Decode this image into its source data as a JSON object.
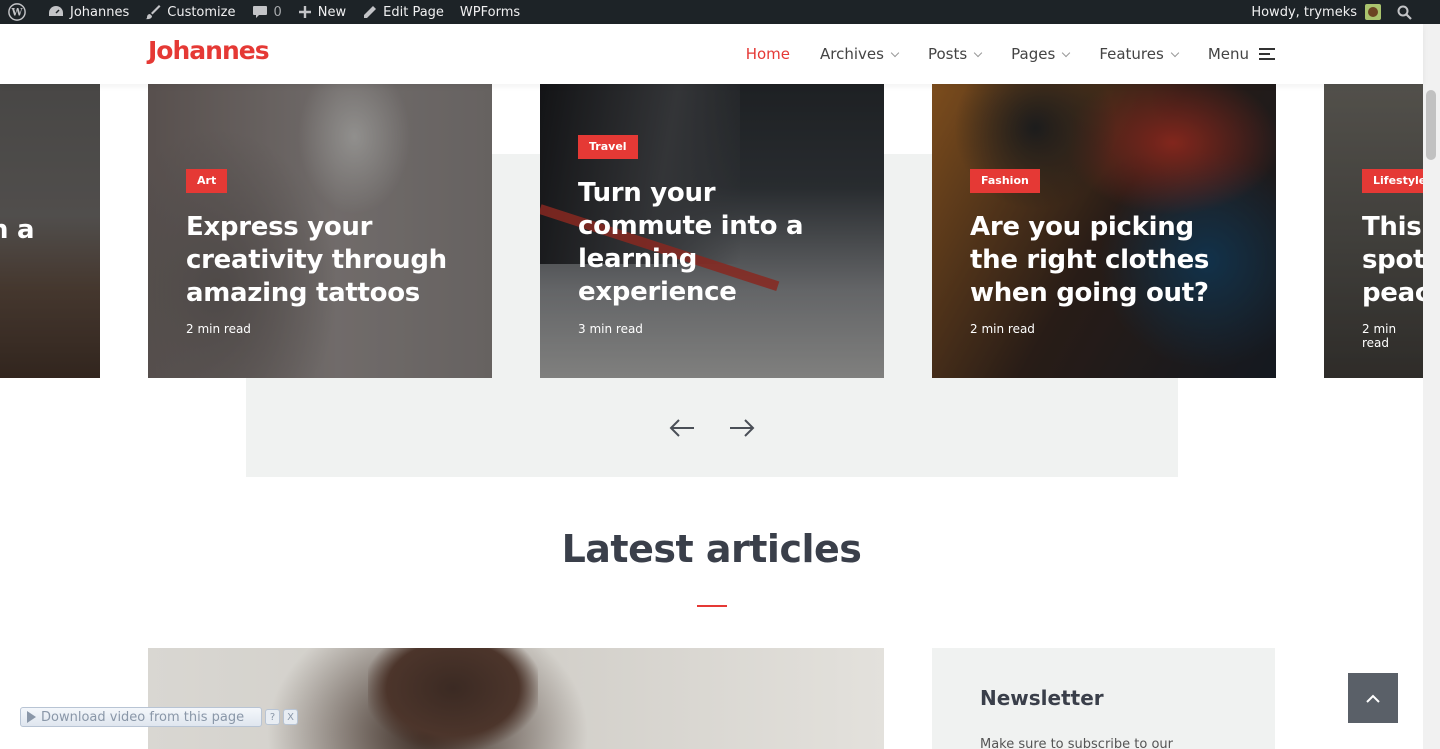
{
  "admin_bar": {
    "site_name": "Johannes",
    "customize": "Customize",
    "comments_count": "0",
    "new": "New",
    "edit_page": "Edit Page",
    "wpforms": "WPForms",
    "howdy": "Howdy, trymeks"
  },
  "header": {
    "logo": "Johannes",
    "nav": [
      "Home",
      "Archives",
      "Posts",
      "Pages",
      "Features",
      "Menu"
    ]
  },
  "slider": {
    "left_partial_title": "n a",
    "slides": [
      {
        "category": "Art",
        "title": "Express your creativity through amazing tattoos",
        "meta": "2 min read"
      },
      {
        "category": "Travel",
        "title": "Turn your commute into a learning experience",
        "meta": "3 min read"
      },
      {
        "category": "Fashion",
        "title": "Are you picking the right clothes when going out?",
        "meta": "2 min read"
      },
      {
        "category": "Lifestyle",
        "title_line1": "This",
        "title_line2": "spot",
        "title_line3": "peac",
        "meta": "2 min read"
      }
    ]
  },
  "latest": {
    "title": "Latest articles"
  },
  "newsletter": {
    "title": "Newsletter",
    "text": "Make sure to subscribe to our"
  },
  "download_bar": {
    "label": "Download video from this page",
    "help": "?",
    "close": "X"
  }
}
